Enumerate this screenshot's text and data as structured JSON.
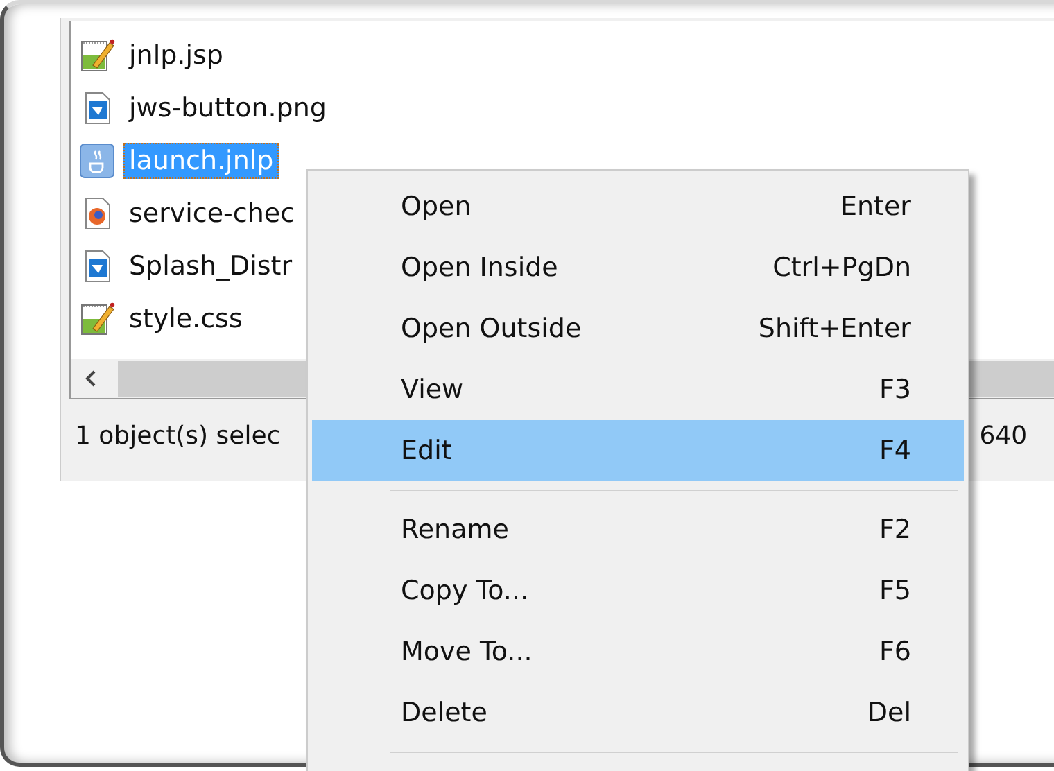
{
  "files": [
    {
      "name": "jnlp.jsp",
      "kind": "text",
      "selected": false
    },
    {
      "name": "jws-button.png",
      "kind": "image",
      "selected": false
    },
    {
      "name": "launch.jnlp",
      "kind": "java",
      "selected": true
    },
    {
      "name": "service-chec",
      "kind": "web",
      "selected": false
    },
    {
      "name": "Splash_Distr",
      "kind": "image",
      "selected": false
    },
    {
      "name": "style.css",
      "kind": "text",
      "selected": false
    }
  ],
  "status_bar": {
    "selection": "1 object(s) selec",
    "size": "640"
  },
  "context_menu": {
    "items": [
      {
        "kind": "item",
        "label": "Open",
        "shortcut": "Enter",
        "selected": false
      },
      {
        "kind": "item",
        "label": "Open Inside",
        "shortcut": "Ctrl+PgDn",
        "selected": false
      },
      {
        "kind": "item",
        "label": "Open Outside",
        "shortcut": "Shift+Enter",
        "selected": false
      },
      {
        "kind": "item",
        "label": "View",
        "shortcut": "F3",
        "selected": false
      },
      {
        "kind": "item",
        "label": "Edit",
        "shortcut": "F4",
        "selected": true
      },
      {
        "kind": "separator"
      },
      {
        "kind": "item",
        "label": "Rename",
        "shortcut": "F2",
        "selected": false
      },
      {
        "kind": "item",
        "label": "Copy To...",
        "shortcut": "F5",
        "selected": false
      },
      {
        "kind": "item",
        "label": "Move To...",
        "shortcut": "F6",
        "selected": false
      },
      {
        "kind": "item",
        "label": "Delete",
        "shortcut": "Del",
        "selected": false
      },
      {
        "kind": "separator"
      }
    ]
  }
}
